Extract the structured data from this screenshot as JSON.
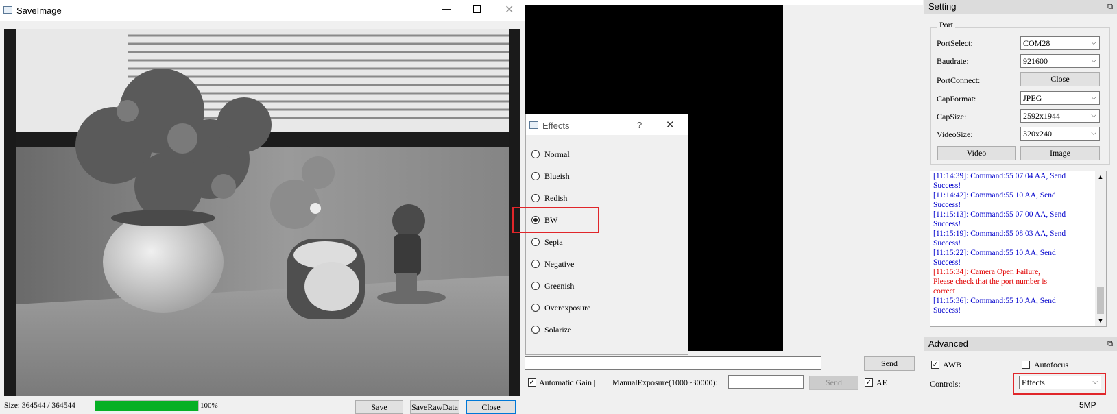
{
  "main": {
    "command_send_label": "Send",
    "automatic_gain_label": "Automatic Gain |",
    "manual_exposure_label": "ManualExposure(1000~30000):",
    "exposure_send_label": "Send",
    "ae_label": "AE"
  },
  "saveimage": {
    "title": "SaveImage",
    "size_text": "Size: 364544 / 364544",
    "progress_value": 1.0,
    "progress_text": "100%",
    "save_label": "Save",
    "save_raw_label": "SaveRawData",
    "close_label": "Close"
  },
  "effects": {
    "title": "Effects",
    "help_glyph": "?",
    "options": [
      "Normal",
      "Blueish",
      "Redish",
      "BW",
      "Sepia",
      "Negative",
      "Greenish",
      "Overexposure",
      "Solarize"
    ],
    "selected": "BW"
  },
  "setting": {
    "title": "Setting",
    "port_group": "Port",
    "port_select_label": "PortSelect:",
    "port_select_value": "COM28",
    "baudrate_label": "Baudrate:",
    "baudrate_value": "921600",
    "port_connect_label": "PortConnect:",
    "port_connect_button": "Close",
    "cap_format_label": "CapFormat:",
    "cap_format_value": "JPEG",
    "cap_size_label": "CapSize:",
    "cap_size_value": "2592x1944",
    "video_size_label": "VideoSize:",
    "video_size_value": "320x240",
    "video_button": "Video",
    "image_button": "Image"
  },
  "log": [
    {
      "text": "[11:14:39]: Command:55 07 04 AA, Send",
      "color": "#0000cc"
    },
    {
      "text": "Success!",
      "color": "#0000cc"
    },
    {
      "text": "[11:14:42]: Command:55 10 AA, Send",
      "color": "#0000cc"
    },
    {
      "text": "Success!",
      "color": "#0000cc"
    },
    {
      "text": "[11:15:13]: Command:55 07 00 AA, Send",
      "color": "#0000cc"
    },
    {
      "text": "Success!",
      "color": "#0000cc"
    },
    {
      "text": "[11:15:19]: Command:55 08 03 AA, Send",
      "color": "#0000cc"
    },
    {
      "text": "Success!",
      "color": "#0000cc"
    },
    {
      "text": "[11:15:22]: Command:55 10 AA, Send",
      "color": "#0000cc"
    },
    {
      "text": "Success!",
      "color": "#0000cc"
    },
    {
      "text": "[11:15:34]: Camera Open Failure,",
      "color": "#e00000"
    },
    {
      "text": "Please check that the port number is",
      "color": "#e00000"
    },
    {
      "text": "correct",
      "color": "#e00000"
    },
    {
      "text": "[11:15:36]: Command:55 10 AA, Send",
      "color": "#0000cc"
    },
    {
      "text": "Success!",
      "color": "#0000cc"
    }
  ],
  "advanced": {
    "title": "Advanced",
    "awb_label": "AWB",
    "autofocus_label": "Autofocus",
    "controls_label": "Controls:",
    "controls_value": "Effects",
    "status_text": "5MP"
  }
}
